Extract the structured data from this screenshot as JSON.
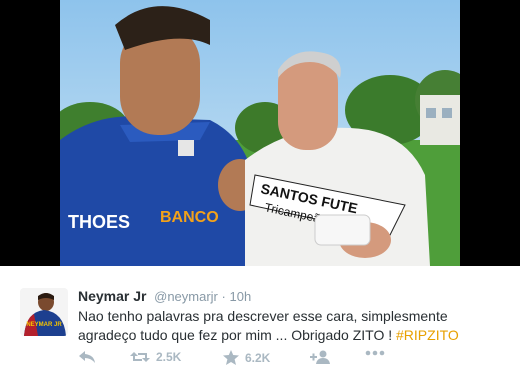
{
  "media": {
    "jersey_text_1": "THOES",
    "jersey_text_2": "BANCO",
    "shirt_text_1": "SANTOS FUTE",
    "shirt_text_2": "Tricampeão"
  },
  "tweet": {
    "display_name": "Neymar Jr",
    "handle": "@neymarjr",
    "separator": "·",
    "time": "10h",
    "text_line1": "Nao tenho palavras pra descrever esse cara, simplesmente",
    "text_line2": "agradeço tudo que fez por mim ... Obrigado ZITO ! ",
    "hashtag": "#RIPZITO",
    "avatar_text": "NEYMAR JR"
  },
  "actions": {
    "retweets": "2.5K",
    "favorites": "6.2K"
  },
  "colors": {
    "hashtag": "#e8a000",
    "name": "#292f33",
    "meta": "#8899a6",
    "icon": "#aab8c2"
  },
  "icons": [
    "reply-icon",
    "retweet-icon",
    "star-icon",
    "follow-icon",
    "more-icon"
  ]
}
